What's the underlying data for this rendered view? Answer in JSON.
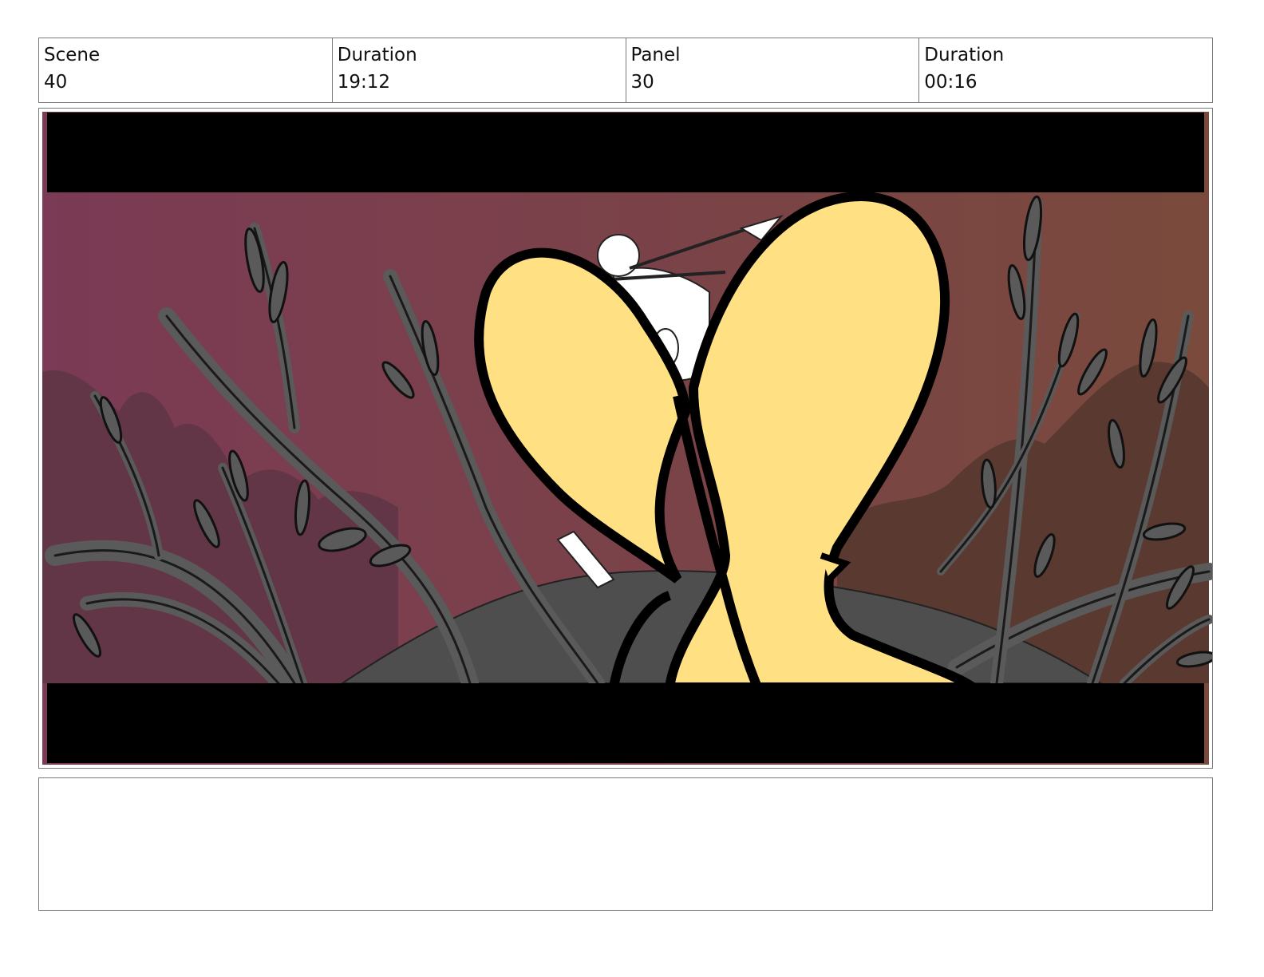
{
  "header": {
    "scene_label": "Scene",
    "scene_value": "40",
    "scene_duration_label": "Duration",
    "scene_duration_value": "19:12",
    "panel_label": "Panel",
    "panel_value": "30",
    "panel_duration_label": "Duration",
    "panel_duration_value": "00:16"
  },
  "panel_image": {
    "colors": {
      "sky_left": "#7b3a55",
      "sky_right": "#7a4a3c",
      "letterbox": "#000000",
      "creature_fill": "#ffe184",
      "branch_fill": "#5a5a5a"
    }
  },
  "notes": {
    "text": ""
  }
}
